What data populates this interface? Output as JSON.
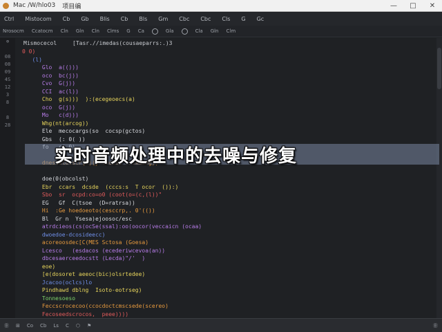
{
  "window": {
    "title": "Mac /W/hlo03",
    "tab": "项目编",
    "controls": [
      "—",
      "□",
      "✕"
    ]
  },
  "menubar": {
    "items": [
      "Ctrl",
      "Mistocom",
      "Cb",
      "Gb",
      "Blis",
      "Cb",
      "Bls",
      "Gm",
      "Cbc",
      "Cbc",
      "Cls",
      "G",
      "Gc"
    ]
  },
  "toolbar": {
    "items": [
      "Nrosocm",
      "Ccatocm",
      "Cln",
      "Gln",
      "Cln",
      "Clms",
      "G",
      "Ca",
      "Gla",
      "Cla",
      "Gln",
      "Clm"
    ]
  },
  "gutter": {
    "lines": [
      "⊕",
      "",
      "08",
      "08",
      "09",
      "4S",
      "12",
      "3",
      "8",
      "",
      "8",
      "28",
      "",
      "",
      "",
      "",
      "",
      "",
      "",
      "",
      "",
      "",
      "",
      "",
      "",
      "",
      "",
      "",
      "",
      "",
      "",
      "",
      "",
      "",
      "",
      "",
      "",
      ""
    ]
  },
  "editor": {
    "filename": "Mismocecol",
    "path": "[Tasr.//imedas(cousaeparrs:.)3",
    "lines": [
      {
        "t": "0 0)",
        "c": "c-red"
      },
      {
        "t": "   (l)",
        "c": "c-blue"
      },
      {
        "t": "      Glo  a(()))",
        "c": "c-purple"
      },
      {
        "t": "      oco  bc(j))",
        "c": "c-purple"
      },
      {
        "t": "      Cvo  G(j))",
        "c": "c-purple"
      },
      {
        "t": "      CCI  ac(l))",
        "c": "c-purple"
      },
      {
        "t": "      Cho  g(s)))  ):(ecegeoecs(a)",
        "c": "c-yellow"
      },
      {
        "t": "      oco  G(j))",
        "c": "c-purple"
      },
      {
        "t": "      Mo   c(d)))",
        "c": "c-purple"
      },
      {
        "t": "      Whg(nt(arcog))",
        "c": "c-yellow"
      },
      {
        "t": "      Ele  mecocargs(so  cocsp(gctos)",
        "c": "c-white"
      },
      {
        "t": "      Gbs  (: 0( ))",
        "c": "c-white"
      },
      {
        "t": "      fo   c( 0)",
        "c": "c-white"
      },
      {
        "t": "",
        "c": "c-white"
      },
      {
        "t": "      dnestatocscr(a)(y tocssc  rskaing))",
        "c": "c-orange"
      },
      {
        "t": "",
        "c": "c-white"
      },
      {
        "t": "      doe(0(obcolst)",
        "c": "c-white"
      },
      {
        "t": "      Ebr  ccars  dcsde  (cccs:s  T ocor  ()):)",
        "c": "c-yellow"
      },
      {
        "t": "      Sbo  sr  ocpd:co=o0 (coot(o=(c,(l))\"",
        "c": "c-red"
      },
      {
        "t": "      EG   Gf  C(tsoe  (D=ratrsa))",
        "c": "c-white"
      },
      {
        "t": "      Hi  :Ge hoedoeoto(cesccrp,. 0'(())",
        "c": "c-orange"
      },
      {
        "t": "      Bl  Gr n  Ysesa)ejoosoc/esc",
        "c": "c-white"
      },
      {
        "t": "      atrdcieos(cs(ocSe(ssal):oo(oocor(veccaicn (ocaa)",
        "c": "c-purple"
      },
      {
        "t": "      dwoedoe-dcosideecc)",
        "c": "c-blue"
      },
      {
        "t": "      acoreoosdec[C(MES Sctosa (Goesa)",
        "c": "c-orange"
      },
      {
        "t": "      Lcesco   (esdacos (ecederiwcevoa(an))",
        "c": "c-purple"
      },
      {
        "t": "      dbcesaerceedocstt (Lecda)\"/'  )",
        "c": "c-purple"
      },
      {
        "t": "      eoe)",
        "c": "c-yellow"
      },
      {
        "t": "      [e(dosoret aeeoc(bic)olsrtedee)",
        "c": "c-yellow"
      },
      {
        "t": "      Jcacoo(oclcs)lo",
        "c": "c-blue"
      },
      {
        "t": "      Pindhawd dblng  Isoto-eotrseg)",
        "c": "c-yellow"
      },
      {
        "t": "      Tonnesoeso",
        "c": "c-green"
      },
      {
        "t": "      Feccscrocecoo(ccocdoctcmscsede(scereo)",
        "c": "c-orange"
      },
      {
        "t": "      Fecoseedscrocos,  peee))))",
        "c": "c-red"
      }
    ]
  },
  "overlay": {
    "title": "实时音频处理中的去噪与修复"
  },
  "statusbar": {
    "items": [
      "Ⓑ",
      "⊞",
      "Co",
      "Cb",
      "Ls",
      "C",
      "⬡",
      "⚑"
    ],
    "right": "Ⓑ"
  }
}
